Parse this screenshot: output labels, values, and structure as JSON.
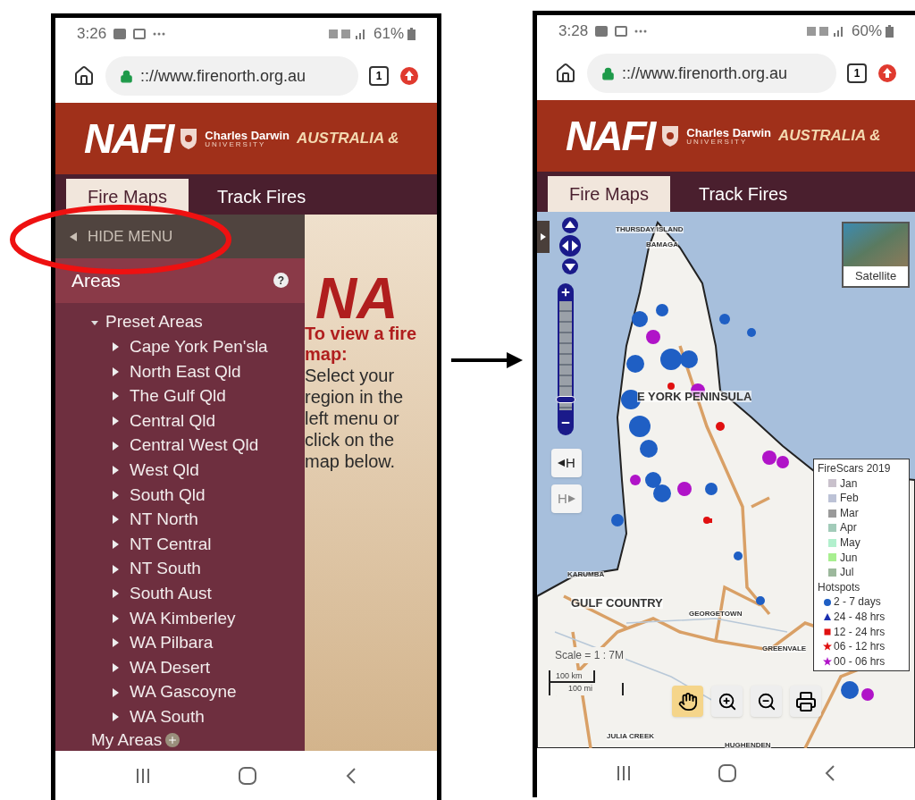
{
  "left_screen": {
    "status_bar": {
      "time": "3:26",
      "battery": "61%"
    },
    "browser": {
      "url": ":://www.firenorth.org.au",
      "tab_count": "1"
    },
    "header": {
      "logo": "NAFI",
      "university": "Charles Darwin",
      "university_sub": "UNIVERSITY",
      "tagline": "AUSTRALIA &"
    },
    "tabs": [
      {
        "label": "Fire Maps",
        "selected": true
      },
      {
        "label": "Track Fires",
        "selected": false
      }
    ],
    "menu": {
      "hide_label": "HIDE MENU",
      "areas_title": "Areas",
      "help": "?",
      "tree": [
        {
          "label": "Preset Areas",
          "expanded": true,
          "children": [
            {
              "label": "Cape York Pen'sla",
              "expanded": false
            },
            {
              "label": "North East Qld",
              "expanded": false
            },
            {
              "label": "The Gulf Qld",
              "expanded": false
            },
            {
              "label": "Central Qld",
              "expanded": false
            },
            {
              "label": "Central West Qld",
              "expanded": false
            },
            {
              "label": "West Qld",
              "expanded": false
            },
            {
              "label": "South Qld",
              "expanded": false
            },
            {
              "label": "NT North",
              "expanded": false
            },
            {
              "label": "NT Central",
              "expanded": false
            },
            {
              "label": "NT South",
              "expanded": false
            },
            {
              "label": "South Aust",
              "expanded": false
            },
            {
              "label": "WA Kimberley",
              "expanded": false
            },
            {
              "label": "WA Pilbara",
              "expanded": false
            },
            {
              "label": "WA Desert",
              "expanded": false
            },
            {
              "label": "WA Gascoyne",
              "expanded": false
            },
            {
              "label": "WA South",
              "expanded": false
            }
          ]
        }
      ],
      "my_areas": "My Areas"
    },
    "content": {
      "logo": "NA",
      "heading": "To view a fire map:",
      "text": "Select your region in the left menu or click on the map below."
    }
  },
  "right_screen": {
    "status_bar": {
      "time": "3:28",
      "battery": "60%"
    },
    "browser": {
      "url": ":://www.firenorth.org.au",
      "tab_count": "1"
    },
    "header": {
      "logo": "NAFI",
      "university": "Charles Darwin",
      "university_sub": "UNIVERSITY",
      "tagline": "AUSTRALIA &"
    },
    "tabs": [
      {
        "label": "Fire Maps",
        "selected": true
      },
      {
        "label": "Track Fires",
        "selected": false
      }
    ],
    "map": {
      "labels": [
        "THURSDAY ISLAND",
        "BAMAGA",
        "E YORK PENINSULA",
        "KARUMBA",
        "GULF COUNTRY",
        "GEORGETOWN",
        "GREENVALE",
        "JULIA CREEK",
        "HUGHENDEN"
      ],
      "zoom": {
        "level": 0.1
      },
      "history": [
        {
          "label": "H",
          "kind": "back",
          "disabled": false
        },
        {
          "label": "H",
          "kind": "forward",
          "disabled": true
        }
      ],
      "satellite": "Satellite",
      "scale": "Scale = 1 : 7M",
      "scale_bar": [
        "100 km",
        "100 mi"
      ],
      "tools": [
        {
          "kind": "pan",
          "selected": true
        },
        {
          "kind": "zoom_in",
          "selected": false
        },
        {
          "kind": "zoom_out",
          "selected": false
        },
        {
          "kind": "print",
          "selected": false
        }
      ],
      "legend": {
        "title": "FireScars 2019",
        "months": [
          {
            "label": "Jan",
            "color": "#c9c1cc"
          },
          {
            "label": "Feb",
            "color": "#bcc2d6"
          },
          {
            "label": "Mar",
            "color": "#9a9a9a"
          },
          {
            "label": "Apr",
            "color": "#a2cbb9"
          },
          {
            "label": "May",
            "color": "#b2f0cd"
          },
          {
            "label": "Jun",
            "color": "#a8ef90"
          },
          {
            "label": "Jul",
            "color": "#9cb89c"
          }
        ],
        "hotspots_title": "Hotspots",
        "hotspots": [
          {
            "label": "2 - 7 days",
            "kind": "circle",
            "color": "#1f5fc4"
          },
          {
            "label": "24 - 48 hrs",
            "kind": "triangle",
            "color": "#1a2fb0"
          },
          {
            "label": "12 - 24 hrs",
            "kind": "square",
            "color": "#e01010"
          },
          {
            "label": "06 - 12 hrs",
            "kind": "star",
            "color": "#e01010"
          },
          {
            "label": "00 - 06 hrs",
            "kind": "star",
            "color": "#b014c8"
          }
        ]
      }
    }
  }
}
